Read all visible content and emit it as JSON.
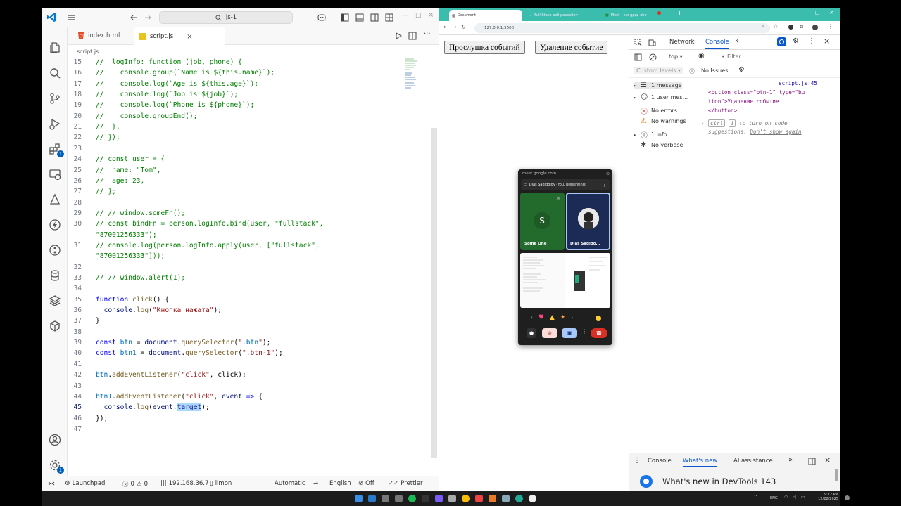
{
  "vscode": {
    "search": "js-1",
    "tabs": [
      {
        "label": "index.html",
        "icon": "html5-icon"
      },
      {
        "label": "script.js",
        "icon": "js-icon"
      }
    ],
    "breadcrumb": "script.js",
    "code_lines": [
      {
        "n": "15",
        "text": "//  logInfo: function (job, phone) {"
      },
      {
        "n": "16",
        "text": "//    console.group(`Name is ${this.name}`);"
      },
      {
        "n": "17",
        "text": "//    console.log(`Age is ${this.age}`);"
      },
      {
        "n": "18",
        "text": "//    console.log(`Job is ${job}`);"
      },
      {
        "n": "19",
        "text": "//    console.log(`Phone is ${phone}`);"
      },
      {
        "n": "20",
        "text": "//    console.groupEnd();"
      },
      {
        "n": "21",
        "text": "//  },"
      },
      {
        "n": "22",
        "text": "// });"
      },
      {
        "n": "23",
        "text": ""
      },
      {
        "n": "24",
        "text": "// const user = {"
      },
      {
        "n": "25",
        "text": "//  name: \"Tom\","
      },
      {
        "n": "26",
        "text": "//  age: 23,"
      },
      {
        "n": "27",
        "text": "// };"
      },
      {
        "n": "28",
        "text": ""
      },
      {
        "n": "29",
        "text": "// // window.someFn();"
      },
      {
        "n": "30",
        "text": "// const bindFn = person.logInfo.bind(user, \"fullstack\","
      },
      {
        "n": "",
        "text": "\"87001256333\");"
      },
      {
        "n": "31",
        "text": "// console.log(person.logInfo.apply(user, [\"fullstack\","
      },
      {
        "n": "",
        "text": "\"87001256333\"]));"
      },
      {
        "n": "32",
        "text": ""
      },
      {
        "n": "33",
        "text": "// // window.alert(1);"
      },
      {
        "n": "34",
        "text": ""
      },
      {
        "n": "35",
        "text": "function click() {"
      },
      {
        "n": "36",
        "text": "  console.log(\"Кнопка нажата\");"
      },
      {
        "n": "37",
        "text": "}"
      },
      {
        "n": "38",
        "text": ""
      },
      {
        "n": "39",
        "text": "const btn = document.querySelector(\".btn\");"
      },
      {
        "n": "40",
        "text": "const btn1 = document.querySelector(\".btn-1\");"
      },
      {
        "n": "41",
        "text": ""
      },
      {
        "n": "42",
        "text": "btn.addEventListener(\"click\", click);"
      },
      {
        "n": "43",
        "text": ""
      },
      {
        "n": "44",
        "text": "btn1.addEventListener(\"click\", event => {"
      },
      {
        "n": "45",
        "text": "  console.log(event.target);"
      },
      {
        "n": "46",
        "text": "});"
      },
      {
        "n": "47",
        "text": ""
      }
    ],
    "current_line": "45",
    "status": {
      "launchpad": "Launchpad",
      "errors": "0",
      "warnings": "0",
      "ip": "192.168.36.7",
      "user": "limon",
      "indent": "Automatic",
      "lang": "English",
      "off": "Off",
      "prettier": "Prettier"
    },
    "badges": {
      "extensions": "1",
      "settings": "1"
    }
  },
  "browser": {
    "tabs": [
      "Document",
      "Full-Stack-веб-разработч",
      "Meet – sur-gpqz-ohe"
    ],
    "url": "127.0.0.1:5500",
    "buttons": [
      "Прослушка событий",
      "Удаление событие"
    ]
  },
  "devtools": {
    "tabs": [
      "Network",
      "Console"
    ],
    "context": "top",
    "filter_placeholder": "Filter",
    "levels": "Custom levels",
    "issues": "No Issues",
    "sidebar": [
      {
        "label": "1 message",
        "icon": "list-icon"
      },
      {
        "label": "1 user mes...",
        "icon": "user-icon"
      },
      {
        "label": "No errors",
        "icon": "error-icon"
      },
      {
        "label": "No warnings",
        "icon": "warning-icon"
      },
      {
        "label": "1 info",
        "icon": "info-icon"
      },
      {
        "label": "No verbose",
        "icon": "bug-icon"
      }
    ],
    "log_source": "script.js:45",
    "log_lines": [
      "<button class=\"btn-1\" type=\"bu",
      "tton\">Удаление событие",
      "</button>"
    ],
    "hint_key1": "ctrl",
    "hint_key2": "i",
    "hint_text": "to turn on code",
    "hint_text2": "suggestions.",
    "hint_link": "Don't show again",
    "drawer_tabs": [
      "Console",
      "What's new",
      "AI assistance"
    ],
    "whats_new": "What's new in DevTools 143"
  },
  "meet": {
    "url": "meet.google.com",
    "presenting": "Dias Sagidoldy (You, presenting)",
    "tile1_name": "Some One",
    "tile1_initial": "S",
    "tile2_name": "Dias Sagido..."
  },
  "taskbar": {
    "lang": "ENG",
    "time": "9:12 PM",
    "date": "12/22/2025"
  }
}
